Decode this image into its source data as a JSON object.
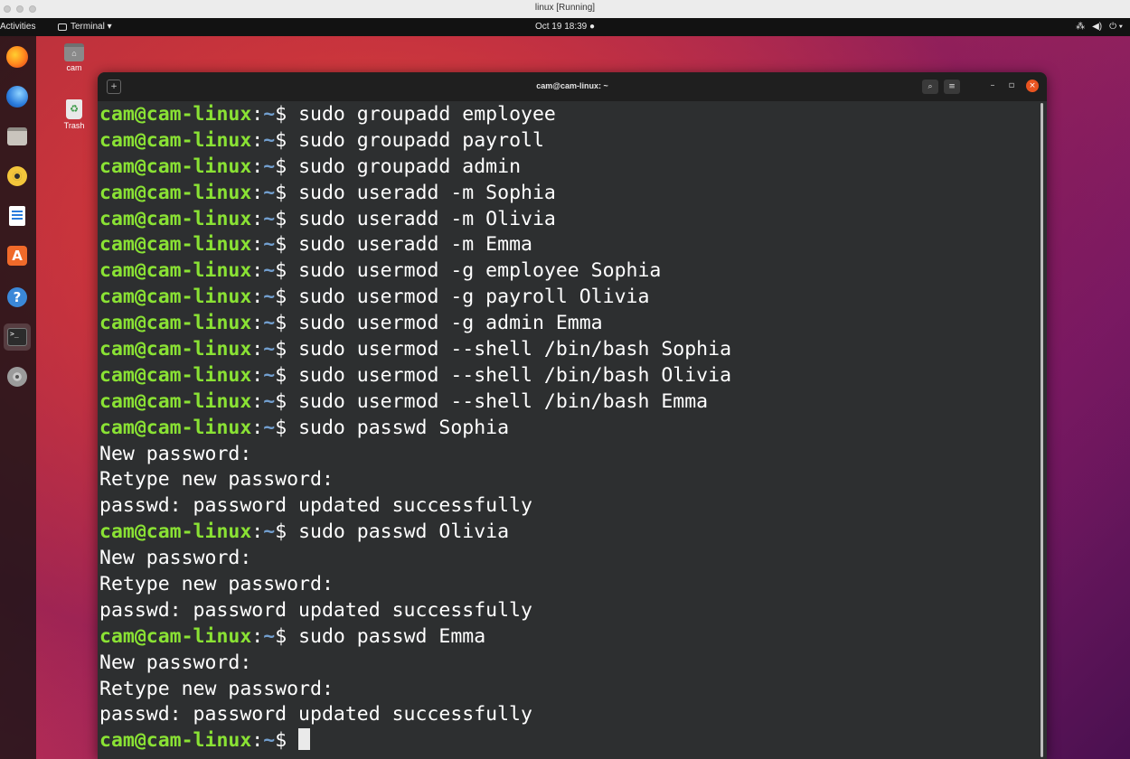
{
  "vm_window": {
    "title": "linux [Running]"
  },
  "top_panel": {
    "activities": "Activities",
    "app_menu": "Terminal ▾",
    "clock": "Oct 19  18:39  ●",
    "tray": [
      "⁂",
      "◀)",
      "⏻ ▾"
    ]
  },
  "desktop": {
    "home_icon_label": "cam",
    "trash_icon_label": "Trash"
  },
  "dock": {
    "items": [
      "firefox-icon",
      "thunderbird-icon",
      "files-icon",
      "rhythmbox-icon",
      "writer-icon",
      "software-icon",
      "help-icon",
      "terminal-icon",
      "settings-icon"
    ]
  },
  "terminal": {
    "title": "cam@cam-linux: ~",
    "prompt_user": "cam@cam-linux",
    "prompt_sep": ":",
    "prompt_path": "~",
    "prompt_char": "$ ",
    "lines": [
      {
        "type": "cmd",
        "text": "sudo groupadd employee"
      },
      {
        "type": "cmd",
        "text": "sudo groupadd payroll"
      },
      {
        "type": "cmd",
        "text": "sudo groupadd admin"
      },
      {
        "type": "cmd",
        "text": "sudo useradd -m Sophia"
      },
      {
        "type": "cmd",
        "text": "sudo useradd -m Olivia"
      },
      {
        "type": "cmd",
        "text": "sudo useradd -m Emma"
      },
      {
        "type": "cmd",
        "text": "sudo usermod -g employee Sophia"
      },
      {
        "type": "cmd",
        "text": "sudo usermod -g payroll Olivia"
      },
      {
        "type": "cmd",
        "text": "sudo usermod -g admin Emma"
      },
      {
        "type": "cmd",
        "text": "sudo usermod --shell /bin/bash Sophia"
      },
      {
        "type": "cmd",
        "text": "sudo usermod --shell /bin/bash Olivia"
      },
      {
        "type": "cmd",
        "text": "sudo usermod --shell /bin/bash Emma"
      },
      {
        "type": "cmd",
        "text": "sudo passwd Sophia"
      },
      {
        "type": "out",
        "text": "New password:"
      },
      {
        "type": "out",
        "text": "Retype new password:"
      },
      {
        "type": "out",
        "text": "passwd: password updated successfully"
      },
      {
        "type": "cmd",
        "text": "sudo passwd Olivia"
      },
      {
        "type": "out",
        "text": "New password:"
      },
      {
        "type": "out",
        "text": "Retype new password:"
      },
      {
        "type": "out",
        "text": "passwd: password updated successfully"
      },
      {
        "type": "cmd",
        "text": "sudo passwd Emma"
      },
      {
        "type": "out",
        "text": "New password:"
      },
      {
        "type": "out",
        "text": "Retype new password:"
      },
      {
        "type": "out",
        "text": "passwd: password updated successfully"
      },
      {
        "type": "prompt",
        "text": ""
      }
    ]
  }
}
